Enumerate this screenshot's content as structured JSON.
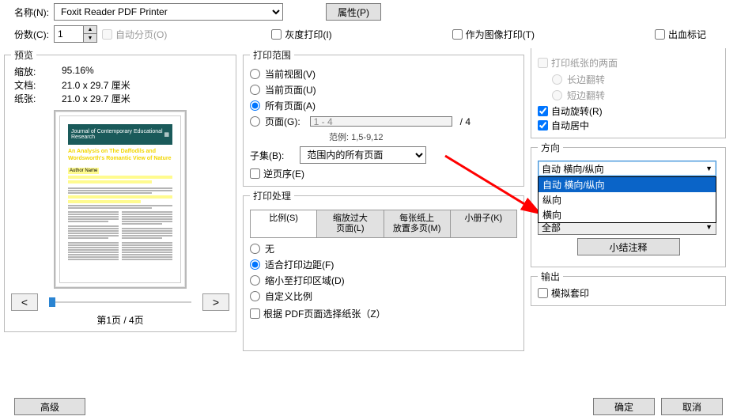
{
  "top": {
    "name_label": "名称(N):",
    "printer": "Foxit Reader PDF Printer",
    "properties_btn": "属性(P)",
    "copies_label": "份数(C):",
    "copies_value": "1",
    "collate": "自动分页(O)",
    "grayscale": "灰度打印(I)",
    "as_image": "作为图像打印(T)",
    "bleed": "出血标记"
  },
  "preview": {
    "legend": "预览",
    "zoom_label": "缩放:",
    "zoom_value": "95.16%",
    "doc_label": "文档:",
    "doc_size": "21.0 x 29.7 厘米",
    "paper_label": "纸张:",
    "paper_size": "21.0 x 29.7 厘米",
    "journal_header": "Journal of Contemporary Educational Research",
    "journal_title": "An Analysis on The Daffodils and Wordsworth's Romantic View of Nature",
    "prev": "<",
    "next": ">",
    "page_text": "第1页 / 4页"
  },
  "range": {
    "legend": "打印范围",
    "current_view": "当前视图(V)",
    "current_page": "当前页面(U)",
    "all_pages": "所有页面(A)",
    "pages": "页面(G):",
    "pages_value": "1 - 4",
    "total": "/  4",
    "example_label": "范例: 1,5-9,12",
    "subset_label": "子集(B):",
    "subset_value": "范围内的所有页面",
    "reverse": "逆页序(E)"
  },
  "handling": {
    "legend": "打印处理",
    "tab_scale": "比例(S)",
    "tab_tile": "缩放过大\n页面(L)",
    "tab_multi": "每张纸上\n放置多页(M)",
    "tab_booklet": "小册子(K)",
    "none": "无",
    "fit": "适合打印边距(F)",
    "shrink": "缩小至打印区域(D)",
    "custom": "自定义比例",
    "choose_by_page": "根据 PDF页面选择纸张（Z）"
  },
  "paper": {
    "both_sides": "打印纸张的两面",
    "long_edge": "长边翻转",
    "short_edge": "短边翻转",
    "auto_rotate": "自动旋转(R)",
    "auto_center": "自动居中"
  },
  "orient": {
    "legend": "方向",
    "selected": "自动 横向/纵向",
    "opt_auto": "自动 横向/纵向",
    "opt_portrait": "纵向",
    "opt_landscape": "横向",
    "what_label": "全部",
    "summarize_btn": "小结注释"
  },
  "output": {
    "legend": "输出",
    "simulate": "模拟套印"
  },
  "bottom": {
    "advanced": "高级",
    "ok": "确定",
    "cancel": "取消"
  }
}
